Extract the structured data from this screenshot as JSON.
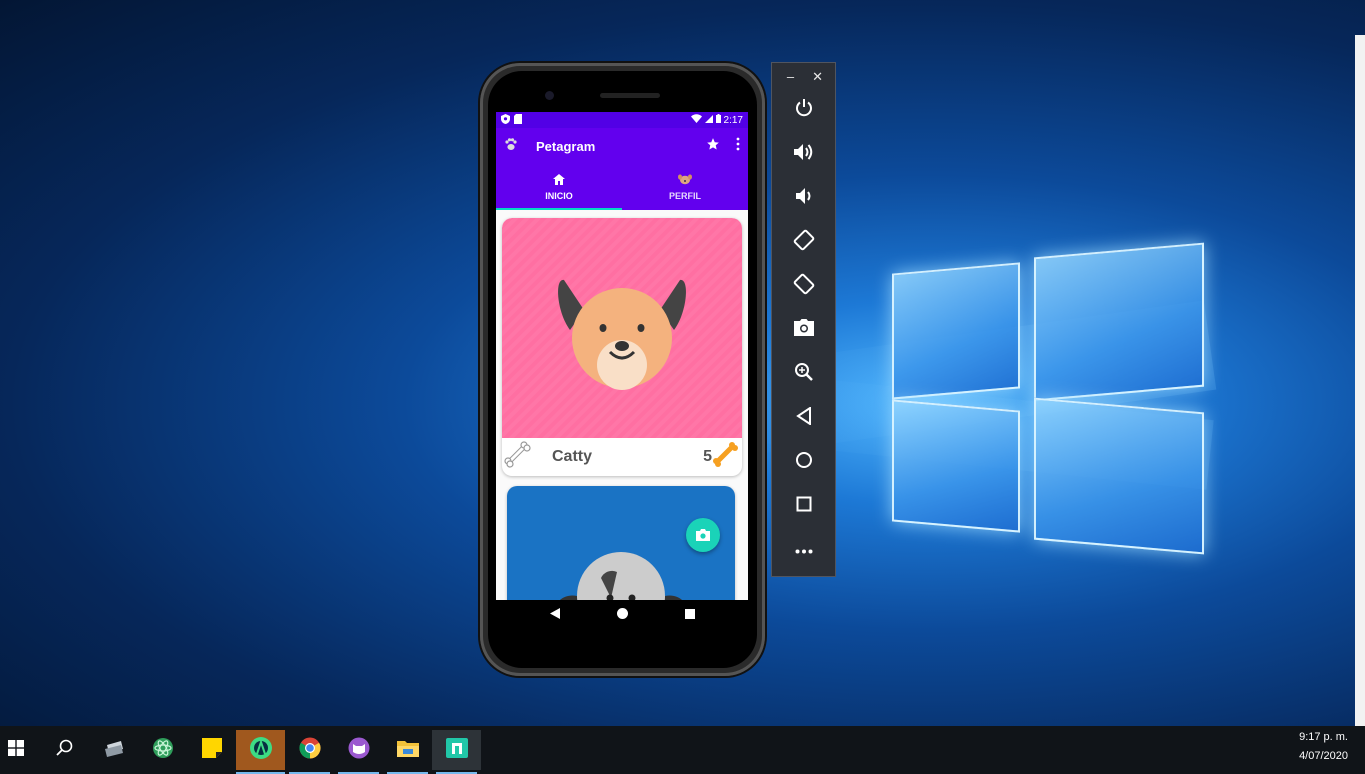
{
  "app": {
    "title": "Petagram",
    "status_time": "2:17",
    "accent": "#6200ee",
    "fab_color": "#1ad3b8"
  },
  "tabs": [
    {
      "label": "INICIO",
      "icon": "home-icon",
      "active": true
    },
    {
      "label": "PERFIL",
      "icon": "dog-face-icon",
      "active": false
    }
  ],
  "pets": [
    {
      "name": "Catty",
      "likes": "5",
      "bg": "#ff6fa2"
    },
    {
      "name": "",
      "likes": "",
      "bg": "#1a73c4"
    }
  ],
  "emulator_controls": [
    {
      "name": "power-icon"
    },
    {
      "name": "volume-up-icon"
    },
    {
      "name": "volume-down-icon"
    },
    {
      "name": "rotate-left-icon"
    },
    {
      "name": "rotate-right-icon"
    },
    {
      "name": "camera-icon"
    },
    {
      "name": "zoom-icon"
    },
    {
      "name": "back-icon"
    },
    {
      "name": "home-circle-icon"
    },
    {
      "name": "overview-icon"
    },
    {
      "name": "more-icon"
    }
  ],
  "emulator_window": {
    "minimize": "–",
    "close": "✕"
  },
  "taskbar": {
    "apps": [
      "start-icon",
      "search-icon",
      "printer-app-icon",
      "atom-icon",
      "sticky-notes-icon",
      "android-studio-icon",
      "chrome-icon",
      "github-desktop-icon",
      "file-explorer-icon",
      "app-icon"
    ],
    "time": "9:17 p. m.",
    "date": "4/07/2020"
  }
}
